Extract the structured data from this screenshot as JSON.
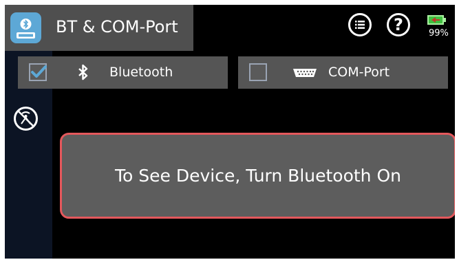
{
  "header": {
    "title": "BT & COM-Port",
    "app_icon": "bluetooth-serial-icon",
    "list_button_icon": "list-icon",
    "help_button_label": "?",
    "battery_level_text": "99%",
    "battery_level": 0.99
  },
  "toggles": {
    "bluetooth": {
      "label": "Bluetooth",
      "checked": true,
      "icon": "bluetooth-icon"
    },
    "com_port": {
      "label": "COM-Port",
      "checked": false,
      "icon": "serial-port-icon"
    }
  },
  "sidebar": {
    "icon": "no-signal-icon"
  },
  "message": {
    "text": "To See Device, Turn Bluetooth On"
  },
  "colors": {
    "background": "#000000",
    "panel": "#555555",
    "accent": "#5da8d6",
    "message_border": "#e4585c",
    "battery": "#3fbf3f"
  }
}
